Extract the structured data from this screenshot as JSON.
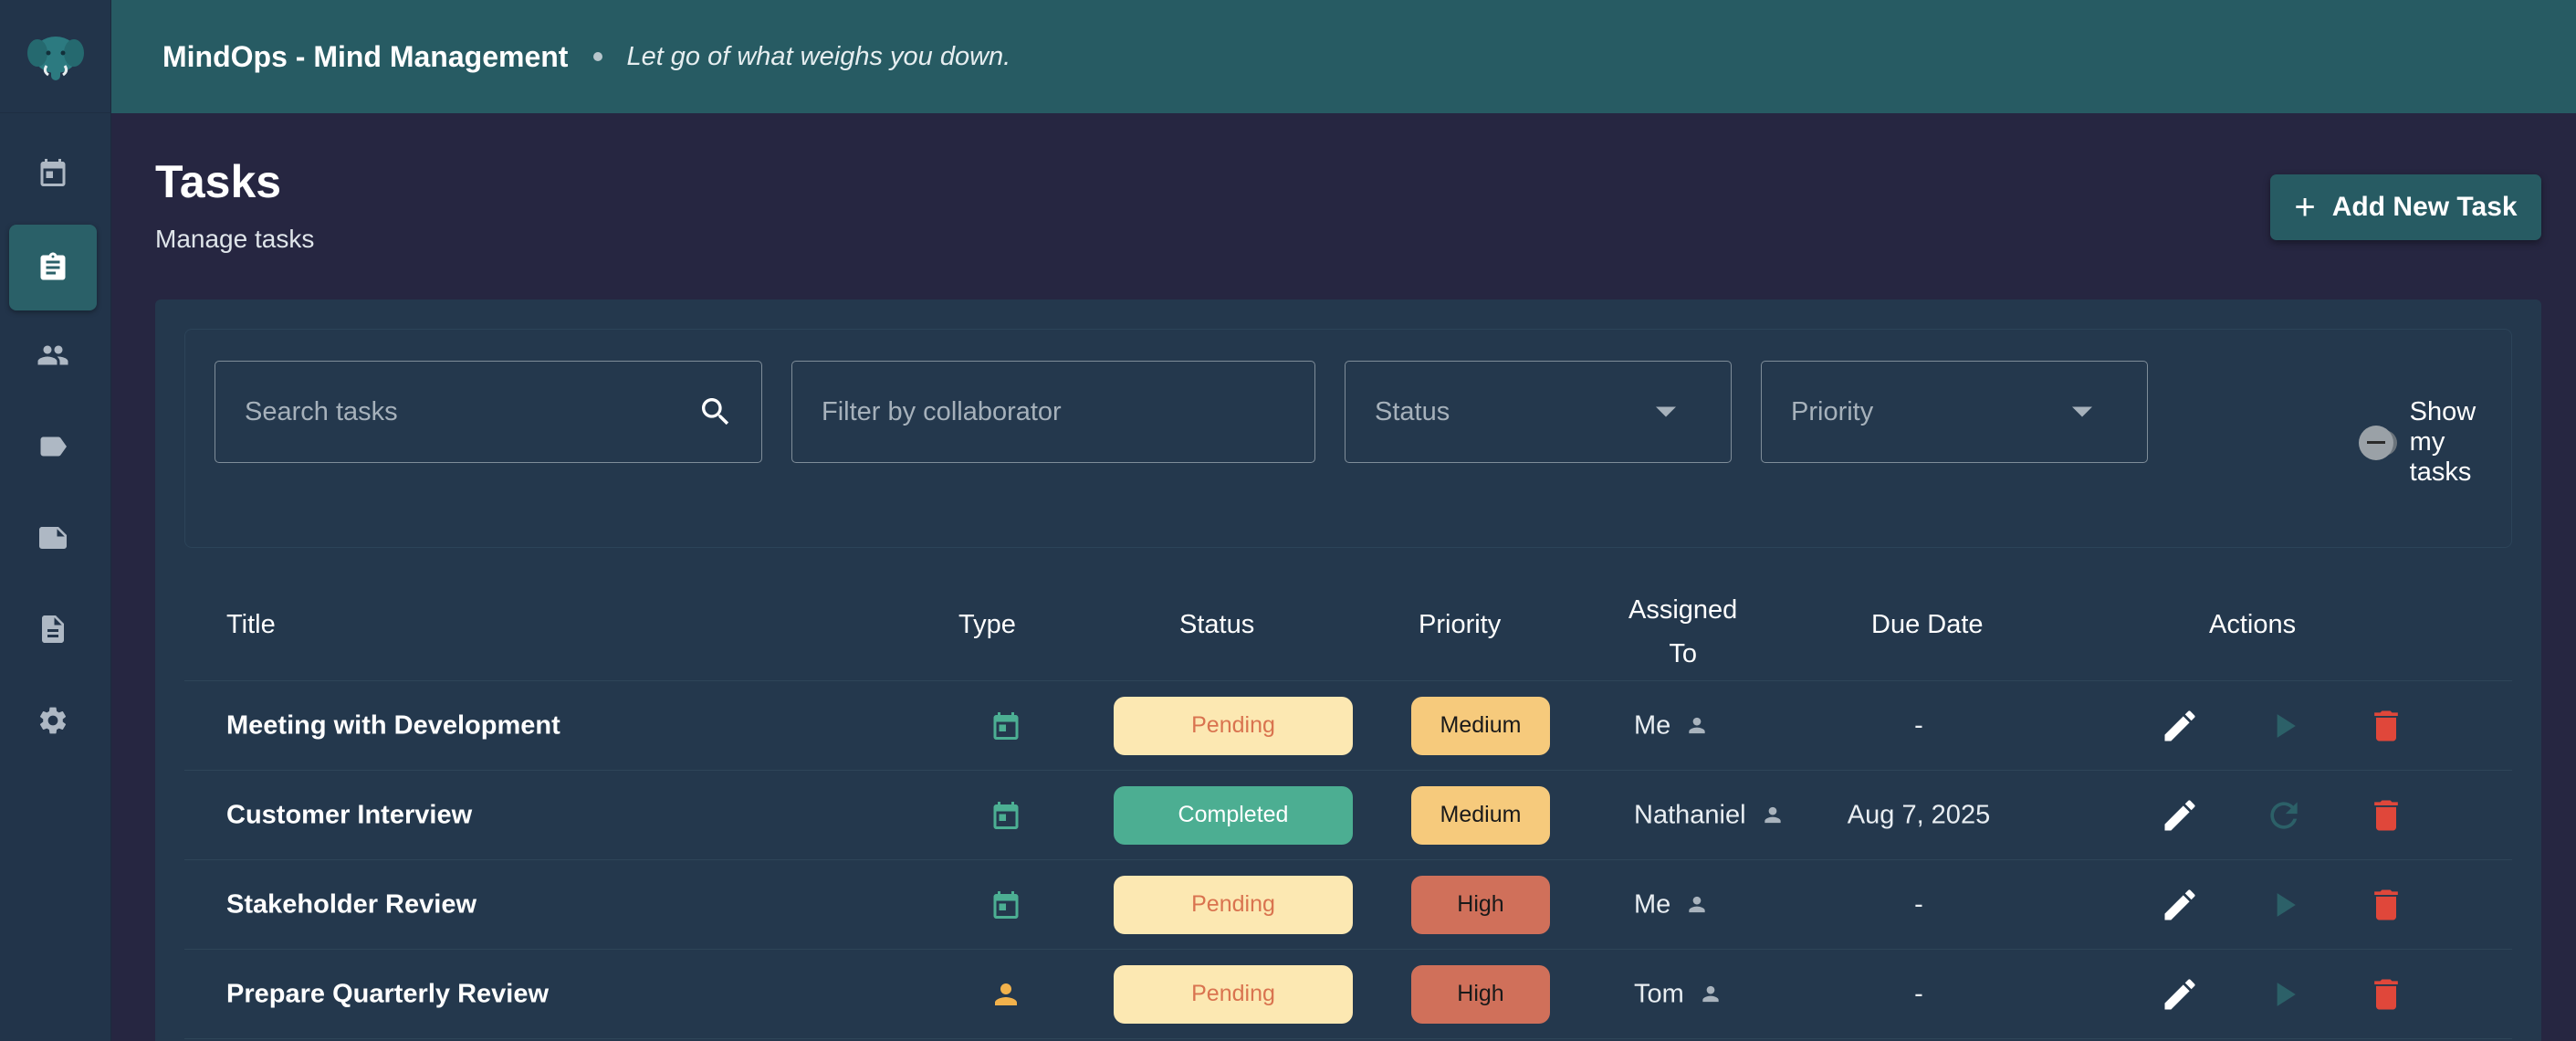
{
  "app": {
    "title": "MindOps - Mind Management",
    "tagline": "Let go of what weighs you down."
  },
  "sidebar": {
    "logo_icon": "elephant-logo-icon",
    "items": [
      {
        "name": "calendar",
        "icon": "calendar-icon",
        "active": false
      },
      {
        "name": "tasks",
        "icon": "clipboard-icon",
        "active": true
      },
      {
        "name": "people",
        "icon": "people-icon",
        "active": false
      },
      {
        "name": "labels",
        "icon": "label-icon",
        "active": false
      },
      {
        "name": "notes",
        "icon": "note-icon",
        "active": false
      },
      {
        "name": "documents",
        "icon": "document-icon",
        "active": false
      },
      {
        "name": "settings",
        "icon": "gear-icon",
        "active": false
      }
    ]
  },
  "page": {
    "title": "Tasks",
    "subtitle": "Manage tasks",
    "add_button_label": "Add New Task"
  },
  "filters": {
    "search_placeholder": "Search tasks",
    "collaborator_placeholder": "Filter by collaborator",
    "status_placeholder": "Status",
    "priority_placeholder": "Priority",
    "show_my_tasks_label": "Show my tasks",
    "show_my_tasks_on": false
  },
  "table": {
    "headers": {
      "title": "Title",
      "type": "Type",
      "status": "Status",
      "priority": "Priority",
      "assigned_line1": "Assigned",
      "assigned_line2": "To",
      "due": "Due Date",
      "actions": "Actions"
    },
    "rows": [
      {
        "title": "Meeting with Development",
        "type": "calendar-icon",
        "status": "Pending",
        "priority": "Medium",
        "assigned": "Me",
        "due": "-",
        "secondary_action": "play-icon"
      },
      {
        "title": "Customer Interview",
        "type": "calendar-icon",
        "status": "Completed",
        "priority": "Medium",
        "assigned": "Nathaniel",
        "due": "Aug 7, 2025",
        "secondary_action": "refresh-icon"
      },
      {
        "title": "Stakeholder Review",
        "type": "calendar-icon",
        "status": "Pending",
        "priority": "High",
        "assigned": "Me",
        "due": "-",
        "secondary_action": "play-icon"
      },
      {
        "title": "Prepare Quarterly Review",
        "type": "person-icon",
        "status": "Pending",
        "priority": "High",
        "assigned": "Tom",
        "due": "-",
        "secondary_action": "play-icon"
      }
    ]
  },
  "colors": {
    "accent": "#275b63",
    "pending_bg": "#fce8b2",
    "pending_text": "#d9734f",
    "completed_bg": "#4cae92",
    "medium_bg": "#f6ca7c",
    "high_bg": "#d0705a",
    "delete": "#e0473a",
    "type_teal": "#4caf93",
    "type_person": "#f2b24c"
  }
}
